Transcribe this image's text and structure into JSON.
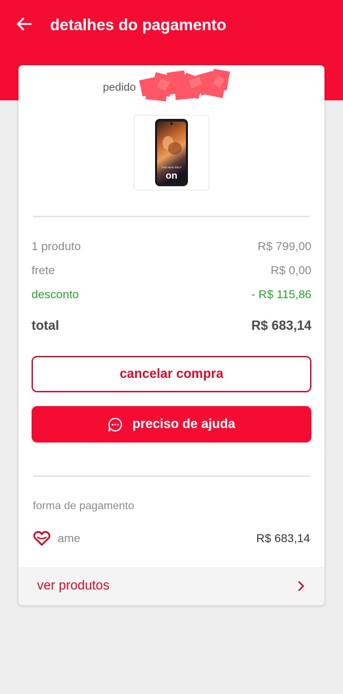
{
  "header": {
    "title": "detalhes do pagamento",
    "back_icon": "arrow-left-icon",
    "background": "#f40c33"
  },
  "order": {
    "label": "pedido",
    "product_image": "smartphone-product-image",
    "screen_text_small": "THE NEW SELF",
    "screen_text_big": "on"
  },
  "summary": {
    "products_label": "1 produto",
    "products_value": "R$ 799,00",
    "shipping_label": "frete",
    "shipping_value": "R$ 0,00",
    "discount_label": "desconto",
    "discount_value": "- R$ 115,86",
    "total_label": "total",
    "total_value": "R$ 683,14"
  },
  "actions": {
    "cancel_label": "cancelar compra",
    "help_label": "preciso de ajuda",
    "help_icon": "chat-bubble-icon"
  },
  "payment": {
    "heading": "forma de pagamento",
    "method_icon": "ame-heart-icon",
    "method_name": "ame",
    "amount": "R$ 683,14"
  },
  "footer_link": {
    "label": "ver produtos",
    "icon": "chevron-right-icon"
  },
  "colors": {
    "brand_red": "#f40c33",
    "dark_red": "#c8102e",
    "discount_green": "#2e9d2e"
  }
}
